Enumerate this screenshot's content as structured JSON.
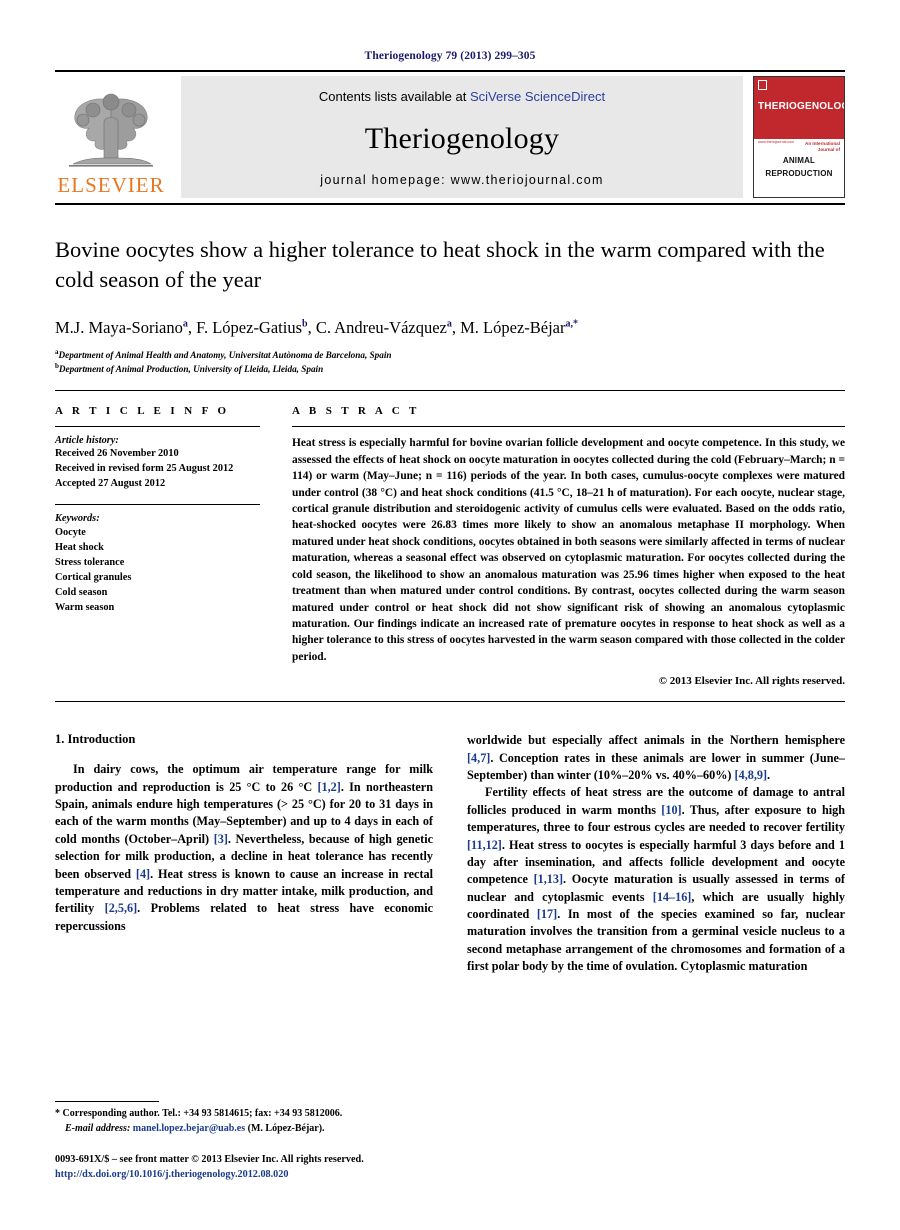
{
  "running_head": "Theriogenology 79 (2013) 299–305",
  "masthead": {
    "contents_prefix": "Contents lists available at ",
    "sciencedirect": "SciVerse ScienceDirect",
    "journal_name": "Theriogenology",
    "homepage": "journal homepage: www.theriojournal.com",
    "publisher_logo_text": "ELSEVIER",
    "cover": {
      "title": "THERIOGENOLOGY",
      "url": "www.theriojournal.com",
      "intl_line1": "An International",
      "intl_line2": "Journal of",
      "animal": "ANIMAL",
      "reproduction": "REPRODUCTION"
    }
  },
  "article": {
    "title": "Bovine oocytes show a higher tolerance to heat shock in the warm compared with the cold season of the year",
    "authors": "M.J. Maya-Soriano , F. López-Gatius , C. Andreu-Vázquez , M. López-Béjar",
    "author_list": [
      {
        "name": "M.J. Maya-Soriano",
        "marks": "a"
      },
      {
        "name": "F. López-Gatius",
        "marks": "b"
      },
      {
        "name": "C. Andreu-Vázquez",
        "marks": "a"
      },
      {
        "name": "M. López-Béjar",
        "marks": "a,*"
      }
    ],
    "affiliations": [
      {
        "mark": "a",
        "text": "Department of Animal Health and Anatomy, Universitat Autònoma de Barcelona, Spain"
      },
      {
        "mark": "b",
        "text": "Department of Animal Production, University of Lleida, Lleida, Spain"
      }
    ]
  },
  "article_info": {
    "heading": "A R T I C L E   I N F O",
    "history_label": "Article history:",
    "history": [
      "Received 26 November 2010",
      "Received in revised form 25 August 2012",
      "Accepted 27 August 2012"
    ],
    "keywords_label": "Keywords:",
    "keywords": [
      "Oocyte",
      "Heat shock",
      "Stress tolerance",
      "Cortical granules",
      "Cold season",
      "Warm season"
    ]
  },
  "abstract": {
    "heading": "A B S T R A C T",
    "text": "Heat stress is especially harmful for bovine ovarian follicle development and oocyte competence. In this study, we assessed the effects of heat shock on oocyte maturation in oocytes collected during the cold (February–March; n = 114) or warm (May–June; n = 116) periods of the year. In both cases, cumulus-oocyte complexes were matured under control (38 °C) and heat shock conditions (41.5 °C, 18–21 h of maturation). For each oocyte, nuclear stage, cortical granule distribution and steroidogenic activity of cumulus cells were evaluated. Based on the odds ratio, heat-shocked oocytes were 26.83 times more likely to show an anomalous metaphase II morphology. When matured under heat shock conditions, oocytes obtained in both seasons were similarly affected in terms of nuclear maturation, whereas a seasonal effect was observed on cytoplasmic maturation. For oocytes collected during the cold season, the likelihood to show an anomalous maturation was 25.96 times higher when exposed to the heat treatment than when matured under control conditions. By contrast, oocytes collected during the warm season matured under control or heat shock did not show significant risk of showing an anomalous cytoplasmic maturation. Our findings indicate an increased rate of premature oocytes in response to heat shock as well as a higher tolerance to this stress of oocytes harvested in the warm season compared with those collected in the colder period.",
    "copyright": "© 2013 Elsevier Inc. All rights reserved."
  },
  "introduction": {
    "heading": "1.  Introduction",
    "left_paragraphs": [
      "In dairy cows, the optimum air temperature range for milk production and reproduction is 25 °C to 26 °C [1,2]. In northeastern Spain, animals endure high temperatures (> 25 °C) for 20 to 31 days in each of the warm months (May–September) and up to 4 days in each of cold months (October–April) [3]. Nevertheless, because of high genetic selection for milk production, a decline in heat tolerance has recently been observed [4]. Heat stress is known to cause an increase in rectal temperature and reductions in dry matter intake, milk production, and fertility [2,5,6]. Problems related to heat stress have economic repercussions"
    ],
    "right_paragraphs": [
      "worldwide but especially affect animals in the Northern hemisphere [4,7]. Conception rates in these animals are lower in summer (June–September) than winter (10%–20% vs. 40%–60%) [4,8,9].",
      "Fertility effects of heat stress are the outcome of damage to antral follicles produced in warm months [10]. Thus, after exposure to high temperatures, three to four estrous cycles are needed to recover fertility [11,12]. Heat stress to oocytes is especially harmful 3 days before and 1 day after insemination, and affects follicle development and oocyte competence [1,13]. Oocyte maturation is usually assessed in terms of nuclear and cytoplasmic events [14–16], which are usually highly coordinated [17]. In most of the species examined so far, nuclear maturation involves the transition from a germinal vesicle nucleus to a second metaphase arrangement of the chromosomes and formation of a first polar body by the time of ovulation. Cytoplasmic maturation"
    ]
  },
  "footnotes": {
    "corresponding": "* Corresponding author. Tel.: +34 93 5814615; fax: +34 93 5812006.",
    "email_label": "E-mail address:",
    "email": "manel.lopez.bejar@uab.es",
    "email_suffix": "(M. López-Béjar).",
    "issn": "0093-691X/$ – see front matter © 2013 Elsevier Inc. All rights reserved.",
    "doi": "http://dx.doi.org/10.1016/j.theriogenology.2012.08.020"
  }
}
